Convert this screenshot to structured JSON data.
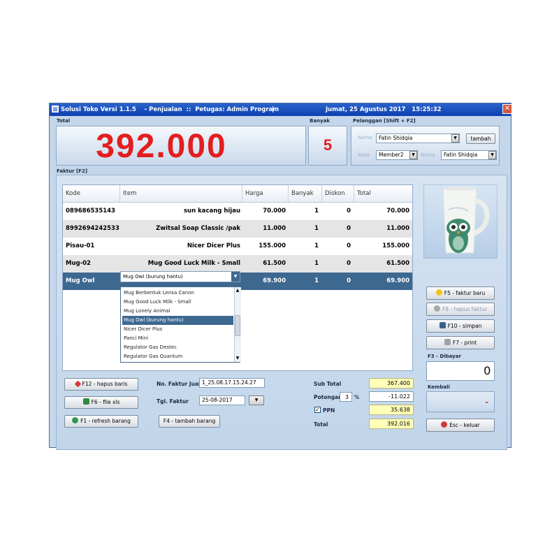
{
  "window": {
    "title": "Solusi Toko Versi 1.1.5    - Penjualan  ::  Petugas: Admin Program",
    "separator": "|",
    "datetime": "Jumat, 25 Agustus 2017   15:25:32",
    "close_glyph": "✕"
  },
  "total": {
    "label": "Total",
    "amount": "392.000"
  },
  "banyak": {
    "label": "Banyak",
    "value": "5"
  },
  "pelanggan": {
    "label": "Pelanggan [Shift + F2]",
    "nama_label": "Nama",
    "nama_value": "Fatin Shidqia",
    "tambah_button": "tambah",
    "kode_label": "Kode",
    "kode_value": "Member2",
    "nama2_label": "Nama",
    "nama2_value": "Fatin Shidqia"
  },
  "faktur_label": "Faktur [F2]",
  "grid": {
    "columns": [
      "Kode",
      "Item",
      "Harga",
      "Banyak",
      "Diskon",
      "Total"
    ],
    "rows": [
      {
        "kode": "089686535143",
        "item": "sun kacang hijau",
        "harga": "70.000",
        "banyak": "1",
        "diskon": "0",
        "total": "70.000"
      },
      {
        "kode": "8992694242533",
        "item": "Zwitsal Soap Classic /pak",
        "harga": "11.000",
        "banyak": "1",
        "diskon": "0",
        "total": "11.000"
      },
      {
        "kode": "Pisau-01",
        "item": "Nicer Dicer Plus",
        "harga": "155.000",
        "banyak": "1",
        "diskon": "0",
        "total": "155.000"
      },
      {
        "kode": "Mug-02",
        "item": "Mug Good Luck Milk - Small",
        "harga": "61.500",
        "banyak": "1",
        "diskon": "0",
        "total": "61.500"
      },
      {
        "kode": "Mug Owl",
        "item": "Mug Owl (burung hantu)",
        "harga": "69.900",
        "banyak": "1",
        "diskon": "0",
        "total": "69.900"
      }
    ],
    "dropdown_options": [
      "Mug Berbentuk Lensa Canon",
      "Mug Good Luck Milk - Small",
      "Mug Lonely Animal",
      "Mug Owl (burung hantu)",
      "Nicer Dicer Plus",
      "Panci Mini",
      "Regulator Gas Destec",
      "Regulator Gas Quantum"
    ],
    "selected_option": "Mug Owl (burung hantu)"
  },
  "buttons": {
    "hapus_baris": "F12 - hapus baris",
    "file_xls": "F6 - file xls",
    "refresh_barang": "F1 - refresh barang",
    "tambah_barang": "F4 - tambah barang",
    "faktur_baru": "F5 - faktur baru",
    "hapus_faktur": "F8 - hapus faktur",
    "simpan": "F10 - simpan",
    "print": "F7 - print",
    "keluar": "Esc - keluar"
  },
  "invoice": {
    "no_faktur_label": "No. Faktur Jual",
    "no_faktur_value": "1_25.08.17.15.24.27",
    "tgl_faktur_label": "Tgl. Faktur",
    "tgl_faktur_value": "25-08-2017"
  },
  "summary": {
    "sub_total_label": "Sub Total",
    "sub_total_value": "367.400",
    "potongan_label": "Potongan",
    "potongan_pct": "3",
    "pct_sign": "%",
    "potongan_value": "-11.022",
    "ppn_label": "PPN",
    "ppn_checked": true,
    "ppn_value": "35.638",
    "total_label": "Total",
    "total_value": "392.016"
  },
  "payment": {
    "dibayar_label": "F3 - Dibayar",
    "dibayar_value": "0",
    "kembali_label": "Kembali",
    "kembali_value": "-"
  },
  "colors": {
    "accent_red": "#e31e1e",
    "selection": "#3d6890",
    "titlebar": "#0e3fb0",
    "highlight_field": "#ffffb8"
  }
}
